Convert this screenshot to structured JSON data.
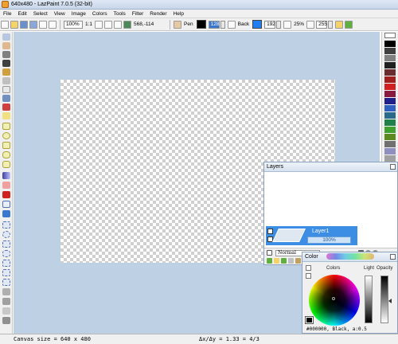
{
  "window": {
    "title": "640x480 - LazPaint 7.0.5 (32-bit)"
  },
  "menu": [
    "File",
    "Edit",
    "Select",
    "View",
    "Image",
    "Colors",
    "Tools",
    "Filter",
    "Render",
    "Help"
  ],
  "toolbar": {
    "zoom": "100%",
    "zoom_ratio": "1:1",
    "cursor_pos": "568,-114",
    "pen_label": "Pen",
    "pen_color": "#000000",
    "pen_alpha": "128",
    "back_label": "Back",
    "back_color": "#1e7ef0",
    "back_alpha": "192",
    "zoom_percent": "25%",
    "opacity": "255"
  },
  "palette_colors": [
    "#000000",
    "#404040",
    "#808080",
    "#202020",
    "#6a2c2c",
    "#a02020",
    "#d02020",
    "#8a1a40",
    "#20208a",
    "#3060c0",
    "#2a6a8a",
    "#20804a",
    "#40a030",
    "#5a8a20",
    "#707070",
    "#9090c0",
    "#a0a0a0",
    "#c0a080",
    "#e07050",
    "#f09090",
    "#c0c0c0",
    "#d0d0d0",
    "#e0e0e0",
    "#f0f0f0"
  ],
  "layers": {
    "title": "Layers",
    "layer_name": "Layer1",
    "layer_opacity": "100%",
    "blend_mode": "Normal"
  },
  "color_panel": {
    "title": "Color",
    "colors_label": "Colors",
    "light_label": "Light",
    "opacity_label": "Opacity",
    "status": "#000000, Black, a:0.5"
  },
  "status": {
    "canvas_size": "Canvas size = 640 x 480",
    "ratio": "Δx/Δy = 1.33 = 4/3"
  }
}
